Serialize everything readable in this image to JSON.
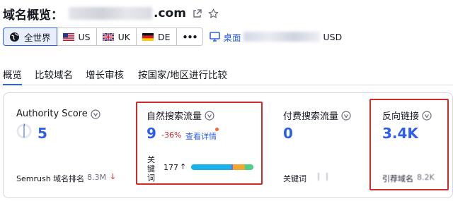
{
  "header": {
    "title_prefix": "域名概览：",
    "domain_suffix": ".com",
    "external_link_icon": "external-link-icon",
    "star_icon": "star-icon"
  },
  "databases": {
    "tabs": [
      {
        "label": "全世界",
        "icon": "globe-icon",
        "active": true
      },
      {
        "label": "US",
        "icon": "flag-us-icon",
        "active": false
      },
      {
        "label": "UK",
        "icon": "flag-uk-icon",
        "active": false
      },
      {
        "label": "DE",
        "icon": "flag-de-icon",
        "active": false
      }
    ],
    "more_label": "•••",
    "device_label": "桌面",
    "currency_label": "USD"
  },
  "nav": {
    "tabs": [
      "概览",
      "比较域名",
      "增长审核",
      "按国家/地区进行比较"
    ]
  },
  "cards": {
    "authority": {
      "title": "Authority Score",
      "value": "5",
      "footer_label": "Semrush 域名排名",
      "footer_value": "8.3M",
      "footer_arrow": "↓"
    },
    "organic": {
      "title": "自然搜索流量",
      "value": "9",
      "change": "-36%",
      "link": "查看详情",
      "keywords_label_1": "关",
      "keywords_label_2": "键",
      "keywords_label_3": "词",
      "keywords_value": "177",
      "keywords_arrow": "↑"
    },
    "paid": {
      "title": "付费搜索流量",
      "value": "0",
      "footer_label": "关键词"
    },
    "backlinks": {
      "title": "反向链接",
      "value": "3.4K",
      "footer_label": "引荐域名",
      "footer_value": "8.2K"
    }
  },
  "colors": {
    "accent": "#2e5ef0",
    "highlight_border": "#d12a2a",
    "negative": "#d12a2a",
    "bar_blue": "#1ab0e8",
    "bar_purple": "#8a5cf6",
    "bar_orange": "#f0a830",
    "bar_green": "#4bcf8a"
  }
}
